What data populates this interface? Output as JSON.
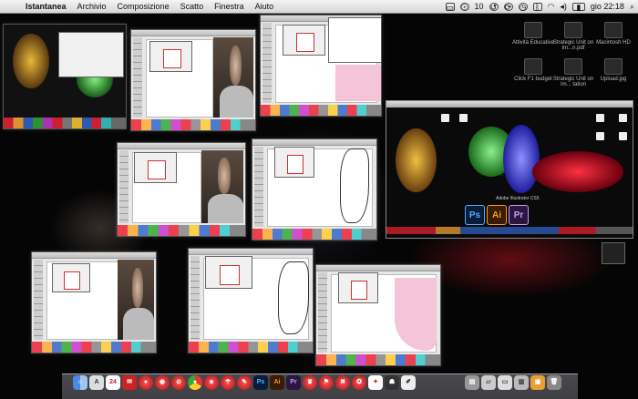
{
  "menubar": {
    "apple_symbol": "",
    "app_name": "Istantanea",
    "menus": [
      "Archivio",
      "Composizione",
      "Scatto",
      "Finestra",
      "Aiuto"
    ],
    "status_number": "10",
    "clock": "gio 22:18"
  },
  "exposed_window": {
    "caption": "Adobe Illustrator CS5"
  },
  "suite_icons": {
    "ps": "Ps",
    "ai": "Ai",
    "pr": "Pr"
  },
  "dock_app_icons": {
    "ps": "Ps",
    "ai": "Ai",
    "pr": "Pr"
  },
  "desktop_icons": [
    {
      "label": "Attività Educative"
    },
    {
      "label": "Strategic Unit on Im...n.pdf"
    },
    {
      "label": "Macintosh HD"
    },
    {
      "label": "Click F1 budget"
    },
    {
      "label": "Strategic Unit on Im... tation"
    },
    {
      "label": "Upload.jpg"
    }
  ],
  "colors": {
    "menubar_bg": "#e6e6e6",
    "desktop_bg": "#050505",
    "ps_accent": "#4cb0ff",
    "ai_accent": "#ff9a1a",
    "pr_accent": "#c89aff"
  }
}
